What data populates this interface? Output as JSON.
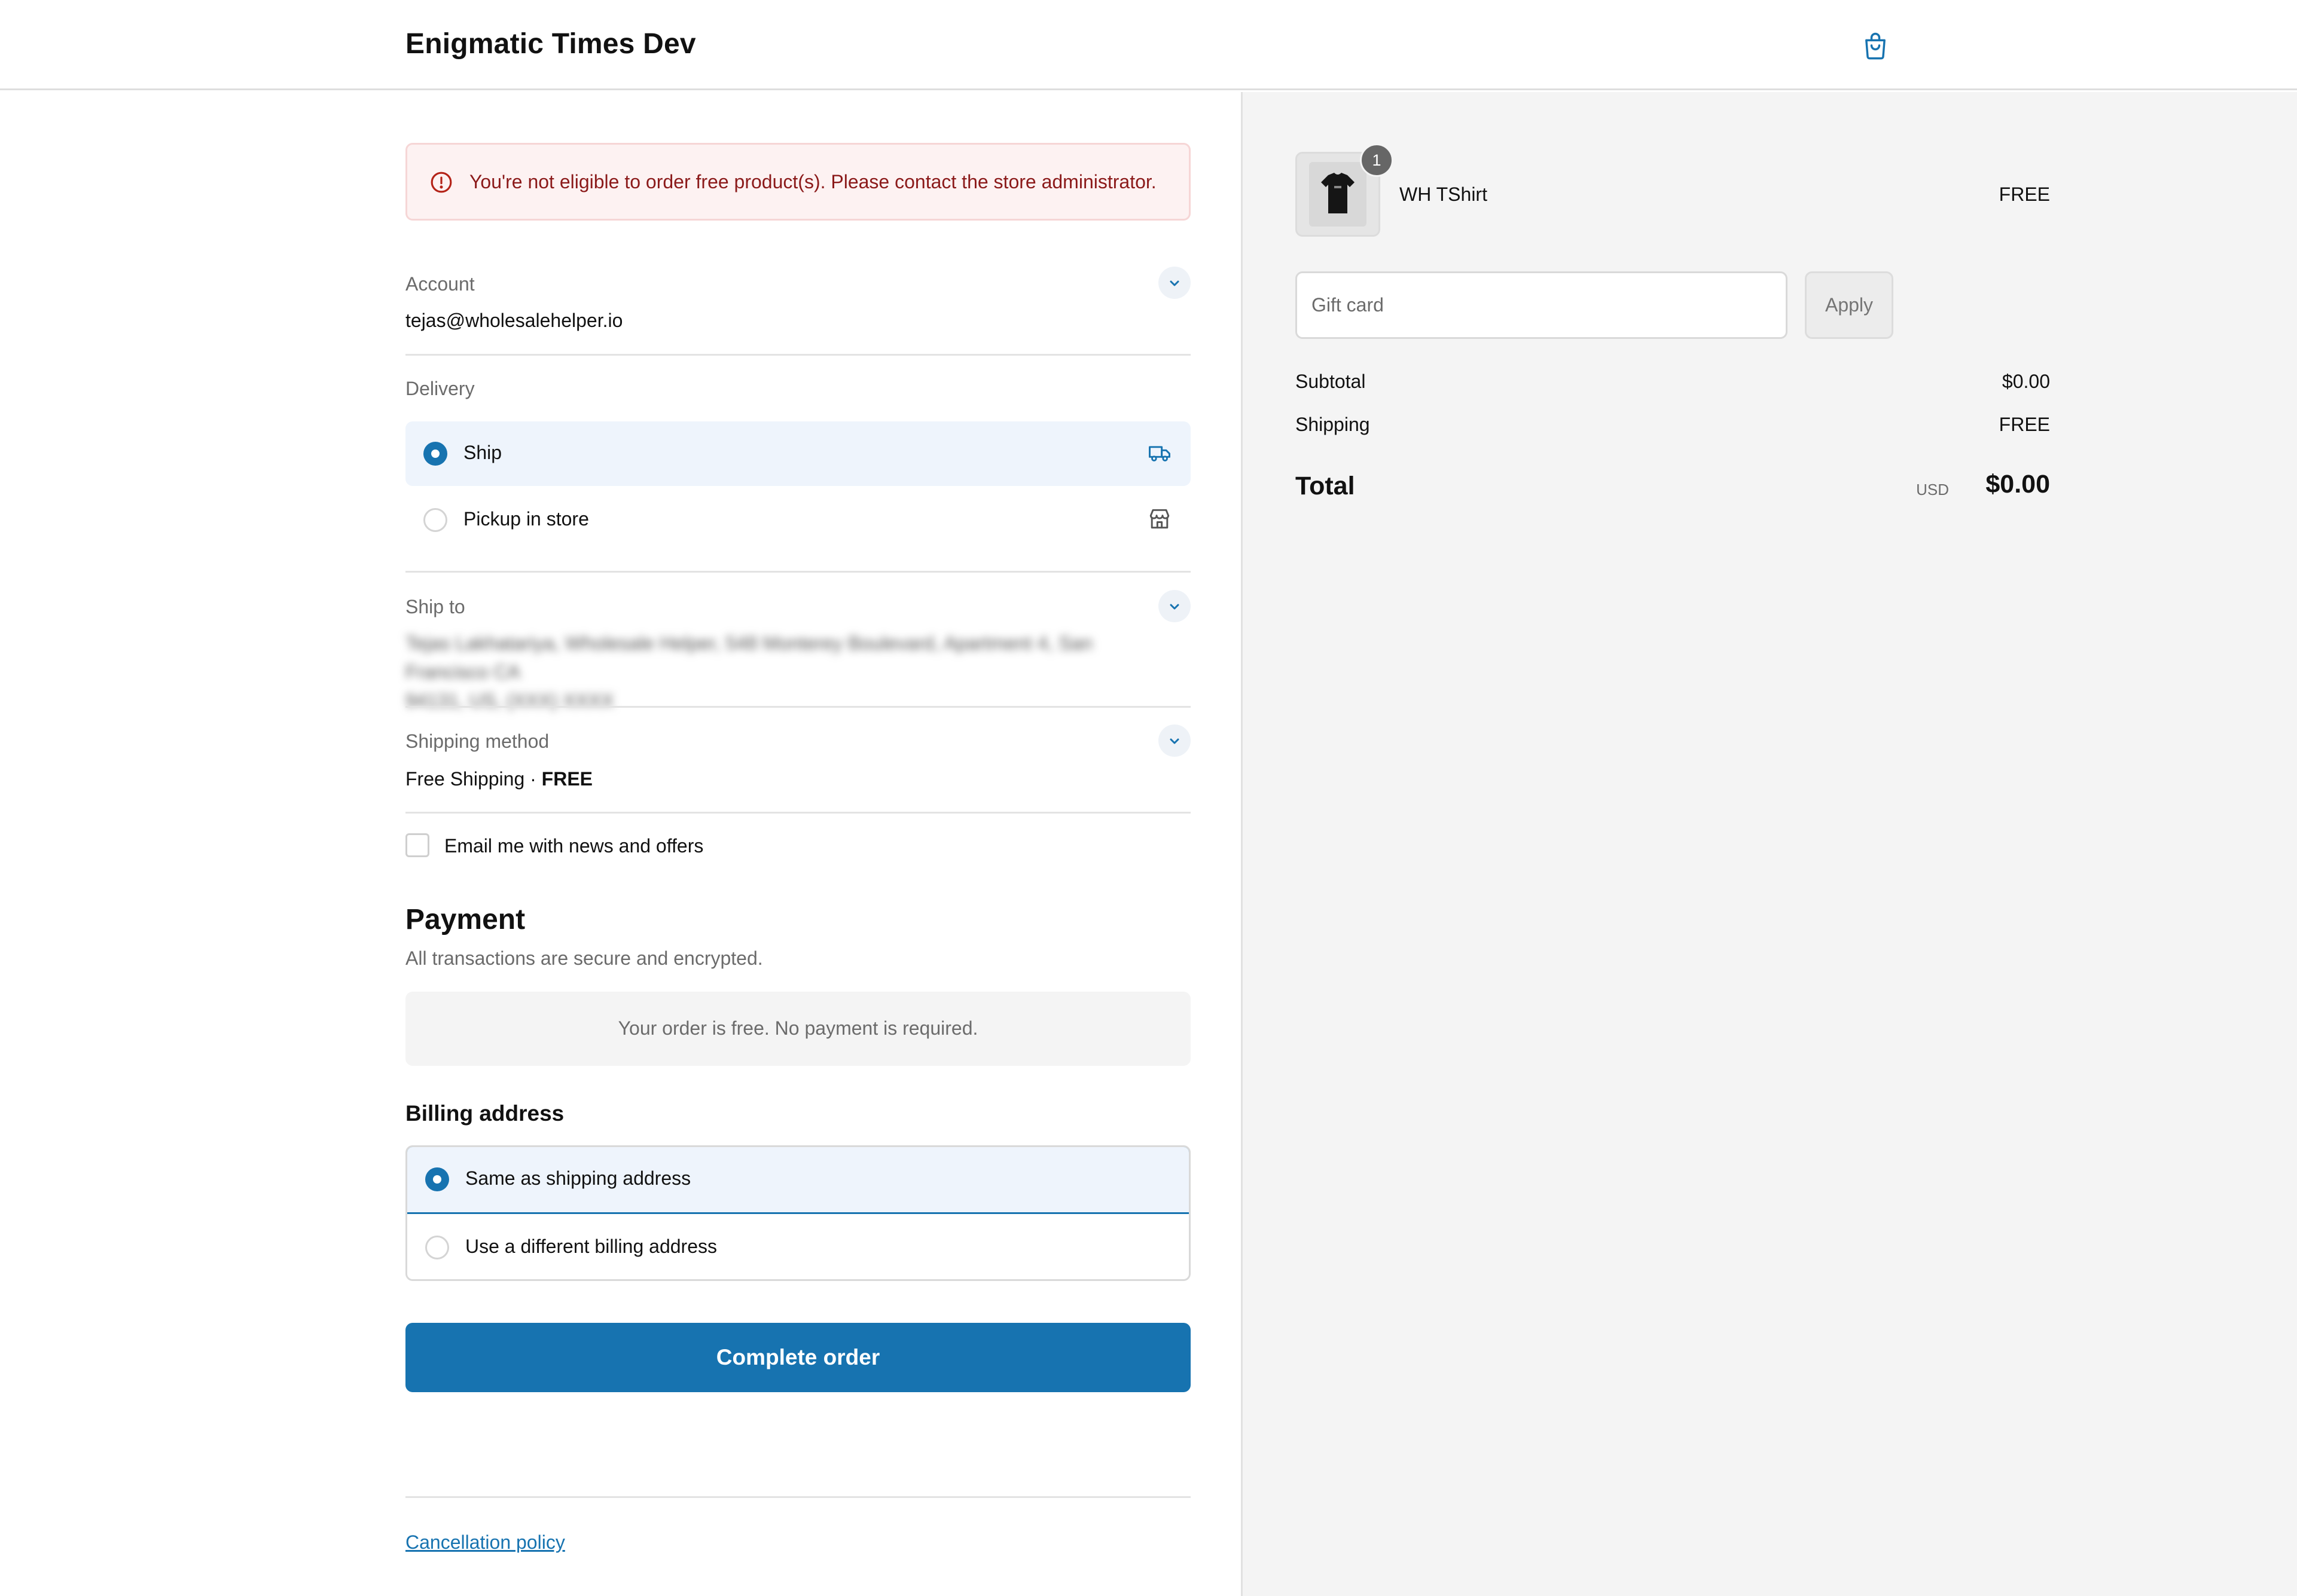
{
  "header": {
    "store_name": "Enigmatic Times Dev",
    "cart_icon": "shopping-bag-icon"
  },
  "alert": {
    "icon": "alert-circle-icon",
    "message": "You're not eligible to order free product(s). Please contact the store administrator."
  },
  "account": {
    "label": "Account",
    "email": "tejas@wholesalehelper.io"
  },
  "delivery": {
    "label": "Delivery",
    "options": [
      {
        "label": "Ship",
        "selected": true,
        "icon": "truck-icon"
      },
      {
        "label": "Pickup in store",
        "selected": false,
        "icon": "store-icon"
      }
    ]
  },
  "ship_to": {
    "label": "Ship to",
    "address_line1": "Tejas Lakhatariya, Wholesale Helper, 548 Monterey Boulevard, Apartment 4, San Francisco CA",
    "address_line2": "94131, US, (XXX) XXXX"
  },
  "shipping_method": {
    "label": "Shipping method",
    "name": "Free Shipping",
    "separator": " · ",
    "price": "FREE"
  },
  "newsletter": {
    "label": "Email me with news and offers",
    "checked": false
  },
  "payment": {
    "title": "Payment",
    "subtitle": "All transactions are secure and encrypted.",
    "free_message": "Your order is free. No payment is required."
  },
  "billing": {
    "title": "Billing address",
    "options": [
      {
        "label": "Same as shipping address",
        "selected": true
      },
      {
        "label": "Use a different billing address",
        "selected": false
      }
    ]
  },
  "complete_button": "Complete order",
  "footer": {
    "cancellation_policy": "Cancellation policy"
  },
  "summary": {
    "item": {
      "name": "WH TShirt",
      "price": "FREE",
      "quantity": "1"
    },
    "gift_card": {
      "placeholder": "Gift card",
      "apply_label": "Apply"
    },
    "subtotal_label": "Subtotal",
    "subtotal_value": "$0.00",
    "shipping_label": "Shipping",
    "shipping_value": "FREE",
    "total_label": "Total",
    "currency": "USD",
    "total_value": "$0.00"
  },
  "colors": {
    "accent": "#1773b0",
    "error_text": "#8b1a1a",
    "error_bg": "#fdf2f2",
    "summary_bg": "#f4f4f4"
  }
}
